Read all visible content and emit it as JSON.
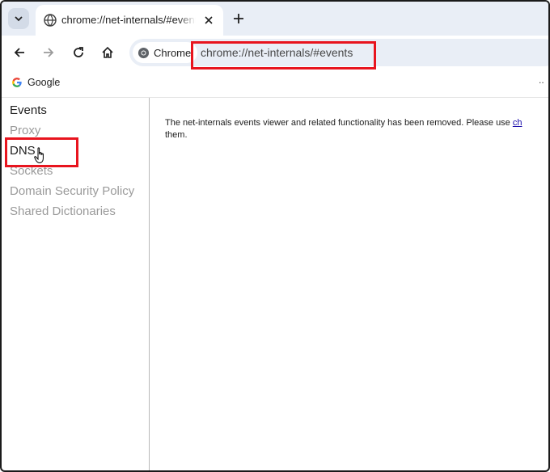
{
  "tabstrip": {
    "tab": {
      "title": "chrome://net-internals/#events"
    }
  },
  "toolbar": {
    "site_chip": "Chrome",
    "url": "chrome://net-internals/#events"
  },
  "bookmarks": {
    "items": [
      {
        "label": "Google"
      }
    ],
    "more": ".."
  },
  "sidebar": {
    "items": [
      {
        "label": "Events",
        "active": true
      },
      {
        "label": "Proxy",
        "active": false
      },
      {
        "label": "DNS",
        "active": false
      },
      {
        "label": "Sockets",
        "active": false
      },
      {
        "label": "Domain Security Policy",
        "active": false
      },
      {
        "label": "Shared Dictionaries",
        "active": false
      }
    ]
  },
  "main": {
    "message_part1": "The net-internals events viewer and related functionality has been removed. Please use ",
    "message_link": "ch",
    "message_part2": "them."
  },
  "colors": {
    "highlight": "#e8141e",
    "tabstrip_bg": "#e9eef6",
    "link": "#1a0dab"
  }
}
